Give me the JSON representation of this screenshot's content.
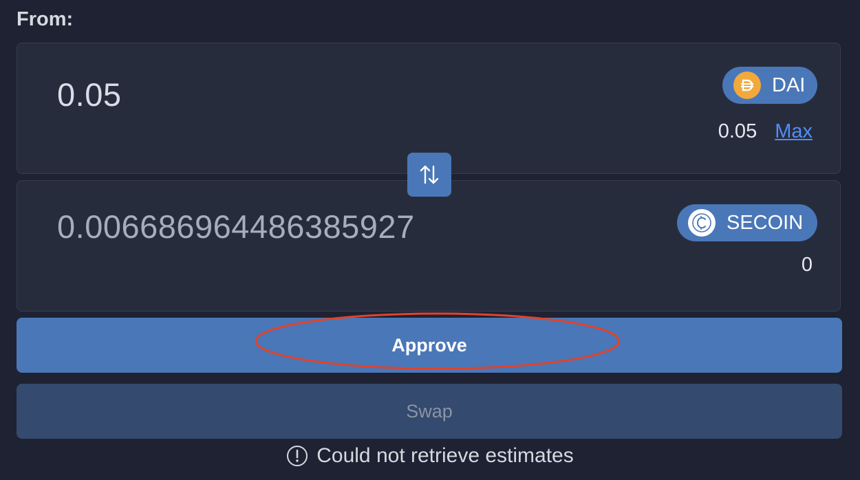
{
  "from_label": "From:",
  "from_panel": {
    "amount": "0.05",
    "token": "DAI",
    "token_icon": "dai-icon",
    "token_color": "#f2a93b",
    "balance": "0.05",
    "max_label": "Max"
  },
  "to_panel": {
    "amount": "0.006686964486385927",
    "token": "SECOIN",
    "token_icon": "secoin-icon",
    "balance": "0"
  },
  "swap_toggle_icon": "swap-arrows-icon",
  "approve_button": {
    "label": "Approve"
  },
  "swap_button": {
    "label": "Swap"
  },
  "status": {
    "icon": "info-icon",
    "text": "Could not retrieve estimates"
  },
  "colors": {
    "accent": "#4a77b8",
    "link": "#4f8ef7",
    "highlight": "#e0432c"
  }
}
